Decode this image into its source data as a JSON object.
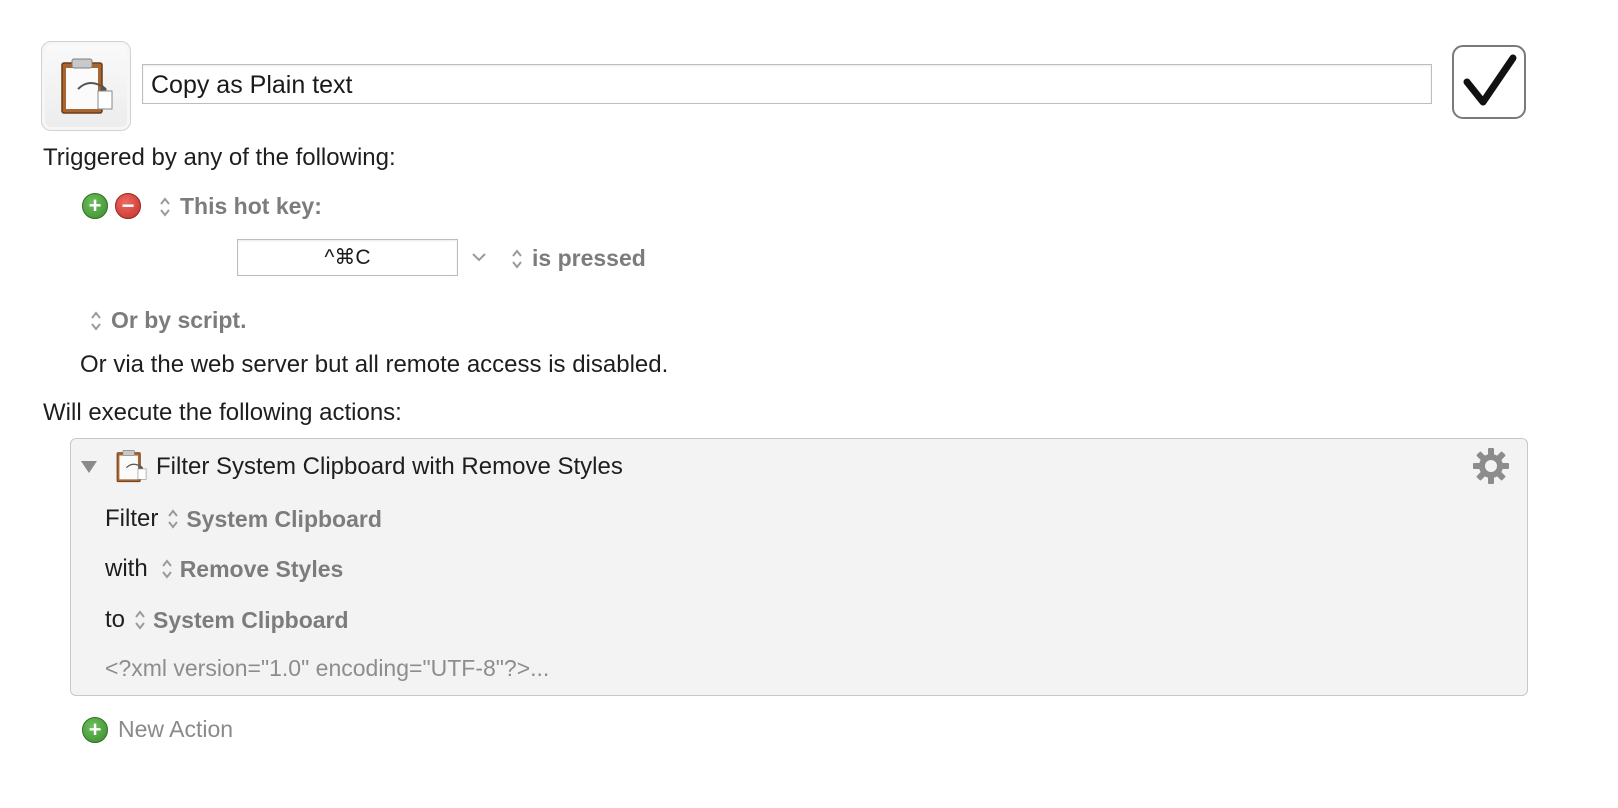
{
  "macro": {
    "name": "Copy as Plain text",
    "icon": "clipboard-icon",
    "enabled": true
  },
  "triggers": {
    "heading": "Triggered by any of the following:",
    "hotkey_label": "This hot key:",
    "hotkey_value": "^⌘C",
    "hotkey_condition": "is pressed",
    "script_label": "Or by script.",
    "web_server_note": "Or via the web server but all remote access is disabled."
  },
  "actions": {
    "heading": "Will execute the following actions:",
    "items": [
      {
        "title": "Filter System Clipboard with Remove Styles",
        "filter_label": "Filter",
        "filter_value": "System Clipboard",
        "with_label": "with",
        "with_value": "Remove Styles",
        "to_label": "to",
        "to_value": "System Clipboard",
        "note": "<?xml version=\"1.0\" encoding=\"UTF-8\"?>..."
      }
    ],
    "new_action_label": "New Action"
  },
  "colors": {
    "add_green": "#4a9e3a",
    "remove_red": "#d03a33",
    "muted_text": "#7c7c7c",
    "panel_bg": "#f3f3f3"
  }
}
